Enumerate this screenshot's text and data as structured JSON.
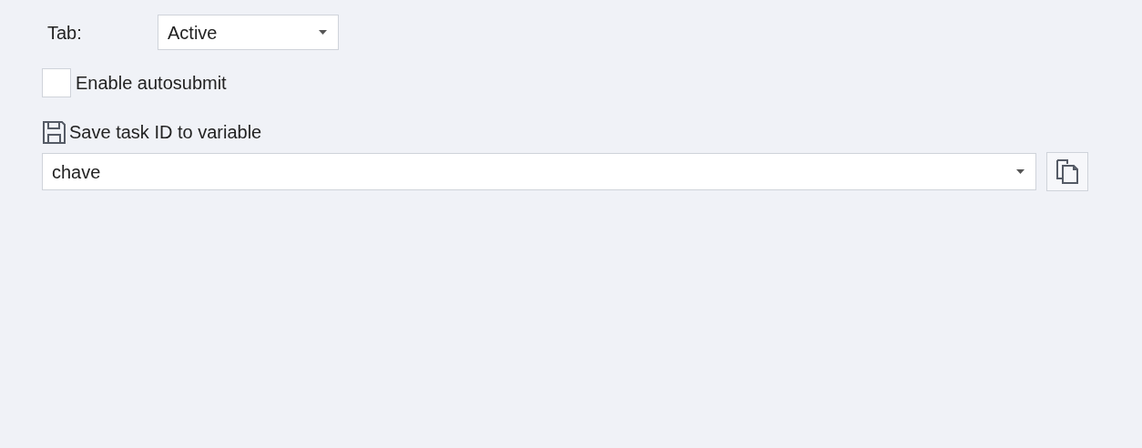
{
  "tab_field": {
    "label": "Tab:",
    "value": "Active"
  },
  "autosubmit": {
    "label": "Enable autosubmit",
    "checked": false
  },
  "save_variable": {
    "label": "Save task ID to variable",
    "value": "chave"
  }
}
